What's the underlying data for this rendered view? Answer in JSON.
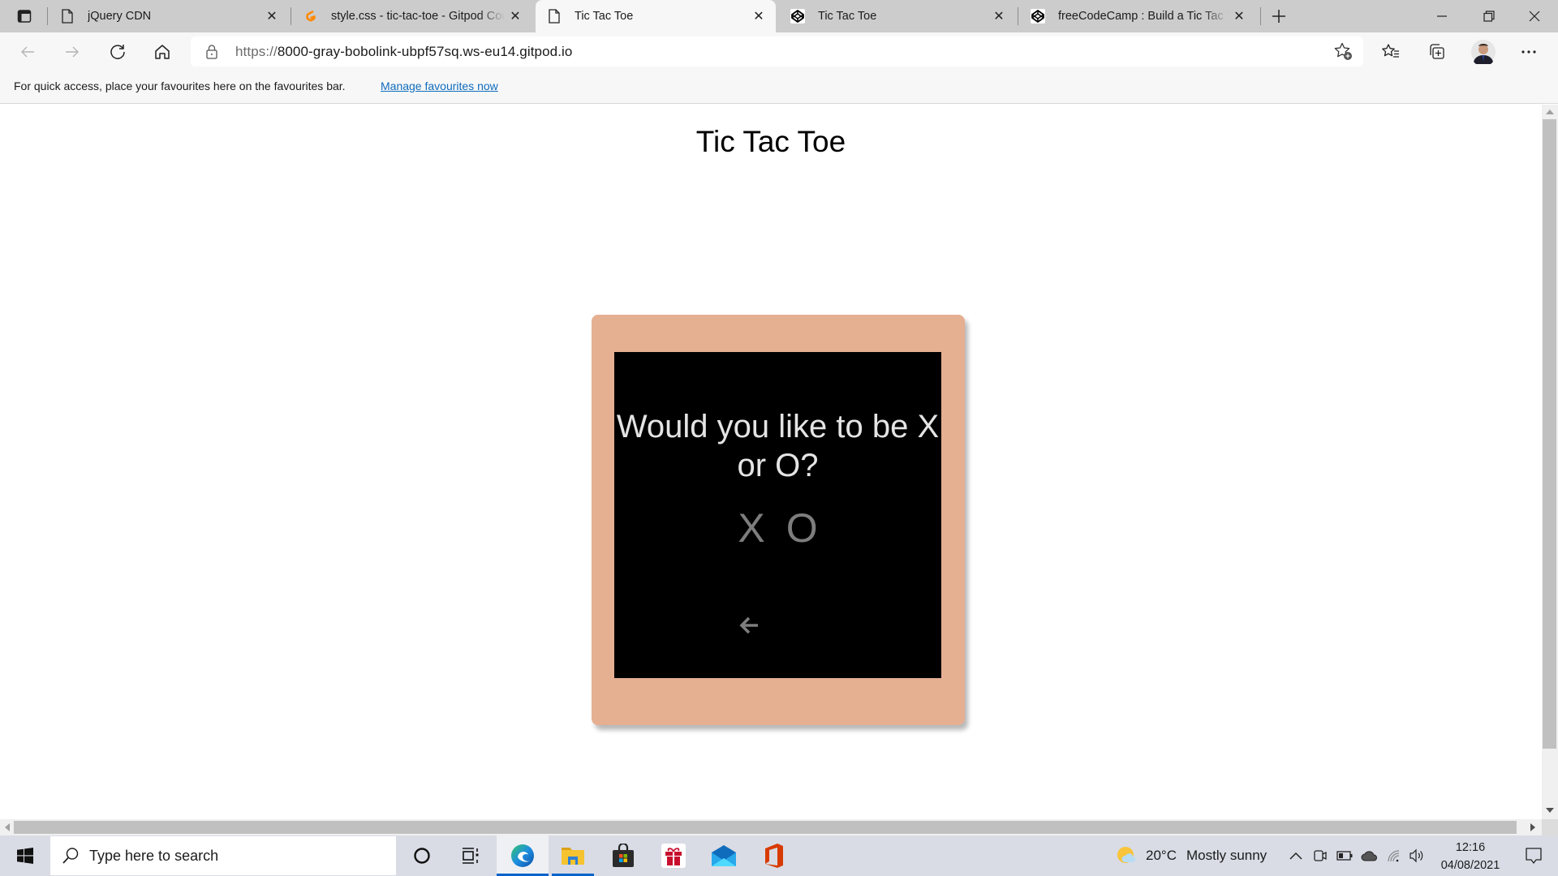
{
  "browser": {
    "tabs": [
      {
        "title": "jQuery CDN",
        "icon": "page-icon",
        "active": false
      },
      {
        "title": "style.css - tic-tac-toe - Gitpod Code",
        "icon": "gitpod-icon",
        "active": false
      },
      {
        "title": "Tic Tac Toe",
        "icon": "page-icon",
        "active": true
      },
      {
        "title": "Tic Tac Toe",
        "icon": "codepen-icon",
        "active": false
      },
      {
        "title": "freeCodeCamp : Build a Tic Tac Toe Game",
        "icon": "codepen-icon",
        "active": false
      }
    ],
    "url_scheme": "https://",
    "url_host": "8000-gray-bobolink-ubpf57sq.ws-eu14.gitpod.io",
    "favourites_bar": {
      "message": "For quick access, place your favourites here on the favourites bar.",
      "link": "Manage favourites now"
    }
  },
  "page": {
    "title": "Tic Tac Toe",
    "question": "Would you like to be X or O?",
    "choices": [
      "X",
      "O"
    ],
    "back_icon": "arrow-left-icon",
    "colors": {
      "card": "#e5af92",
      "screen": "#000000",
      "question_text": "#e4e4e4",
      "choice_text": "#7d7d7d"
    }
  },
  "taskbar": {
    "search_placeholder": "Type here to search",
    "weather": {
      "temp": "20°C",
      "condition": "Mostly sunny"
    },
    "time": "12:16",
    "date": "04/08/2021"
  }
}
